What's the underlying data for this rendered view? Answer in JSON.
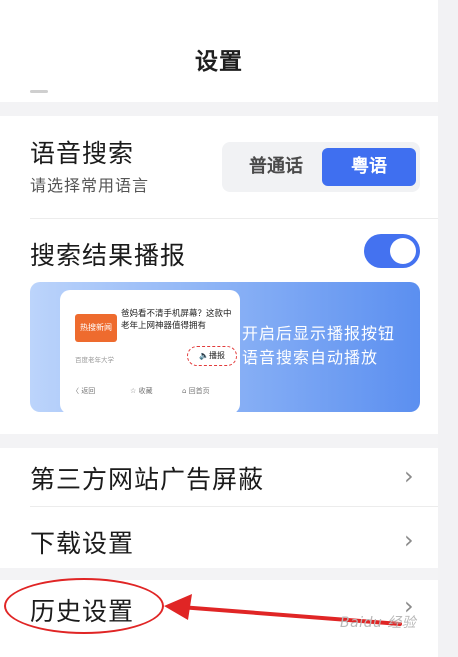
{
  "header": {
    "title": "设置"
  },
  "voice_search": {
    "title": "语音搜索",
    "subtitle": "请选择常用语言",
    "options": [
      "普通话",
      "粤语"
    ],
    "selected": "粤语"
  },
  "search_broadcast": {
    "title": "搜索结果播报",
    "toggle_on": true,
    "preview": {
      "thumb_label": "热搜新闻",
      "headline": "爸妈看不清手机屏幕？这款中老年上网神器值得拥有",
      "source": "百度老年大学",
      "broadcast_button": "🔈播报",
      "nav": [
        "〈 返回",
        "☆ 收藏",
        "⌂ 回首页"
      ],
      "caption_line1": "开启后显示播报按钮",
      "caption_line2": "语音搜索自动播放"
    }
  },
  "menu": {
    "ad_block": "第三方网站广告屏蔽",
    "download": "下载设置",
    "history": "历史设置"
  },
  "watermark": "Baidu 经验",
  "colors": {
    "accent": "#3f6ff0",
    "annotation": "#e02525"
  }
}
